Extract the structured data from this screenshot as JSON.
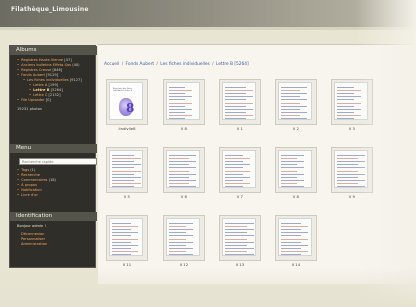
{
  "site": {
    "title": "Filathèque_Limousine"
  },
  "sidebar": {
    "albums": {
      "heading": "Albums",
      "items": [
        {
          "link": "Registres Haute-Vienne",
          "meta": "[47]"
        },
        {
          "link": "Anciens bulletins Effeta-Sas",
          "meta": "(40)"
        },
        {
          "link": "Registres Creuse",
          "meta": "[846]"
        },
        {
          "link": "Fonds Aubert",
          "meta": "[9129]"
        },
        {
          "link": "Les fiches individuelles",
          "meta": "[9127]"
        },
        {
          "link": "Lettre A",
          "meta": "[199]"
        },
        {
          "link": "Lettre B",
          "meta": "[5264]"
        },
        {
          "link": "Lettre C",
          "meta": "[2152]"
        },
        {
          "link": "File Uploader",
          "meta": "[0]"
        }
      ],
      "photo_count": "15231 photos"
    },
    "menu": {
      "heading": "Menu",
      "search_placeholder": "Recherche rapide",
      "items": [
        {
          "link": "Tags",
          "meta": "(1)"
        },
        {
          "link": "Recherche",
          "meta": ""
        },
        {
          "link": "Commentaires",
          "meta": "(18)"
        },
        {
          "link": "À propos",
          "meta": ""
        },
        {
          "link": "Notification",
          "meta": ""
        },
        {
          "link": "Livre d'or",
          "meta": ""
        }
      ]
    },
    "identification": {
      "heading": "Identification",
      "greeting": "Bonjour admin !",
      "links": [
        "Déconnexion",
        "Personnaliser",
        "Administration"
      ]
    }
  },
  "breadcrumb": [
    "Accueil",
    "Fonds Aubert",
    "Les fiches individuelles",
    "Lettre B [5264]"
  ],
  "breadcrumb_separator": "/",
  "thumbnails": [
    {
      "label": "lindivile8"
    },
    {
      "label": "II 8"
    },
    {
      "label": "II 1"
    },
    {
      "label": "II 2"
    },
    {
      "label": "II 3"
    },
    {
      "label": "II 5"
    },
    {
      "label": "II 6"
    },
    {
      "label": "II 7"
    },
    {
      "label": "II 8"
    },
    {
      "label": "II 9"
    },
    {
      "label": "II 11"
    },
    {
      "label": "II 12"
    },
    {
      "label": "II 13"
    },
    {
      "label": "II 14"
    }
  ],
  "first_thumb": {
    "big_char": "8",
    "caption": "Répertoire des fiches individuelles Lettre B"
  },
  "colors": {
    "sidebar_bg": "#2f2e28",
    "link_orange": "#f3a763",
    "breadcrumb_blue": "#3c5aa0",
    "content_bg": "#f7f5ee"
  }
}
